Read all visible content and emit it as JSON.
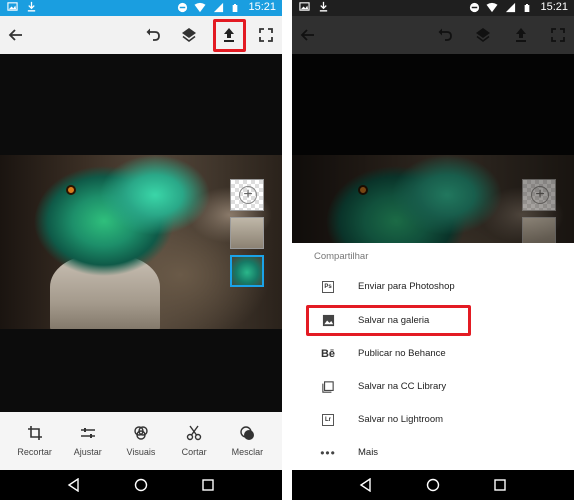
{
  "left": {
    "status_bar": {
      "time": "15:21",
      "left_icons": [
        "image-notification-icon",
        "download-notification-icon"
      ],
      "right_icons": [
        "do-not-disturb-icon",
        "wifi-icon",
        "signal-icon",
        "battery-icon"
      ]
    },
    "toolbar": {
      "icons": [
        "back-arrow-icon",
        "undo-icon",
        "layers-icon",
        "share-upload-icon",
        "fullscreen-icon"
      ],
      "highlighted": "share-upload-icon"
    },
    "tools": [
      {
        "label": "Recortar",
        "icon": "crop-icon"
      },
      {
        "label": "Ajustar",
        "icon": "adjust-sliders-icon"
      },
      {
        "label": "Visuais",
        "icon": "looks-icon"
      },
      {
        "label": "Cortar",
        "icon": "scissors-icon"
      },
      {
        "label": "Mesclar",
        "icon": "blend-icon"
      }
    ]
  },
  "right": {
    "status_bar": {
      "time": "15:21"
    },
    "share_sheet": {
      "title": "Compartilhar",
      "items": [
        {
          "label": "Enviar para Photoshop",
          "icon": "photoshop-icon",
          "glyph": "Ps"
        },
        {
          "label": "Salvar na galeria",
          "icon": "gallery-icon",
          "glyph": ""
        },
        {
          "label": "Publicar no Behance",
          "icon": "behance-icon",
          "glyph": "Bē"
        },
        {
          "label": "Salvar na CC Library",
          "icon": "cc-library-icon",
          "glyph": ""
        },
        {
          "label": "Salvar no Lightroom",
          "icon": "lightroom-icon",
          "glyph": "Lr"
        },
        {
          "label": "Mais",
          "icon": "more-dots-icon",
          "glyph": "•••"
        }
      ],
      "highlighted": "Salvar na galeria"
    }
  },
  "nav_bar": {
    "icons": [
      "back-triangle-icon",
      "home-circle-icon",
      "recents-square-icon"
    ]
  },
  "colors": {
    "status_left": "#1a9ee0",
    "status_right": "#1f1f1f",
    "highlight": "#e31b23",
    "selected_layer": "#1aa3e8"
  }
}
